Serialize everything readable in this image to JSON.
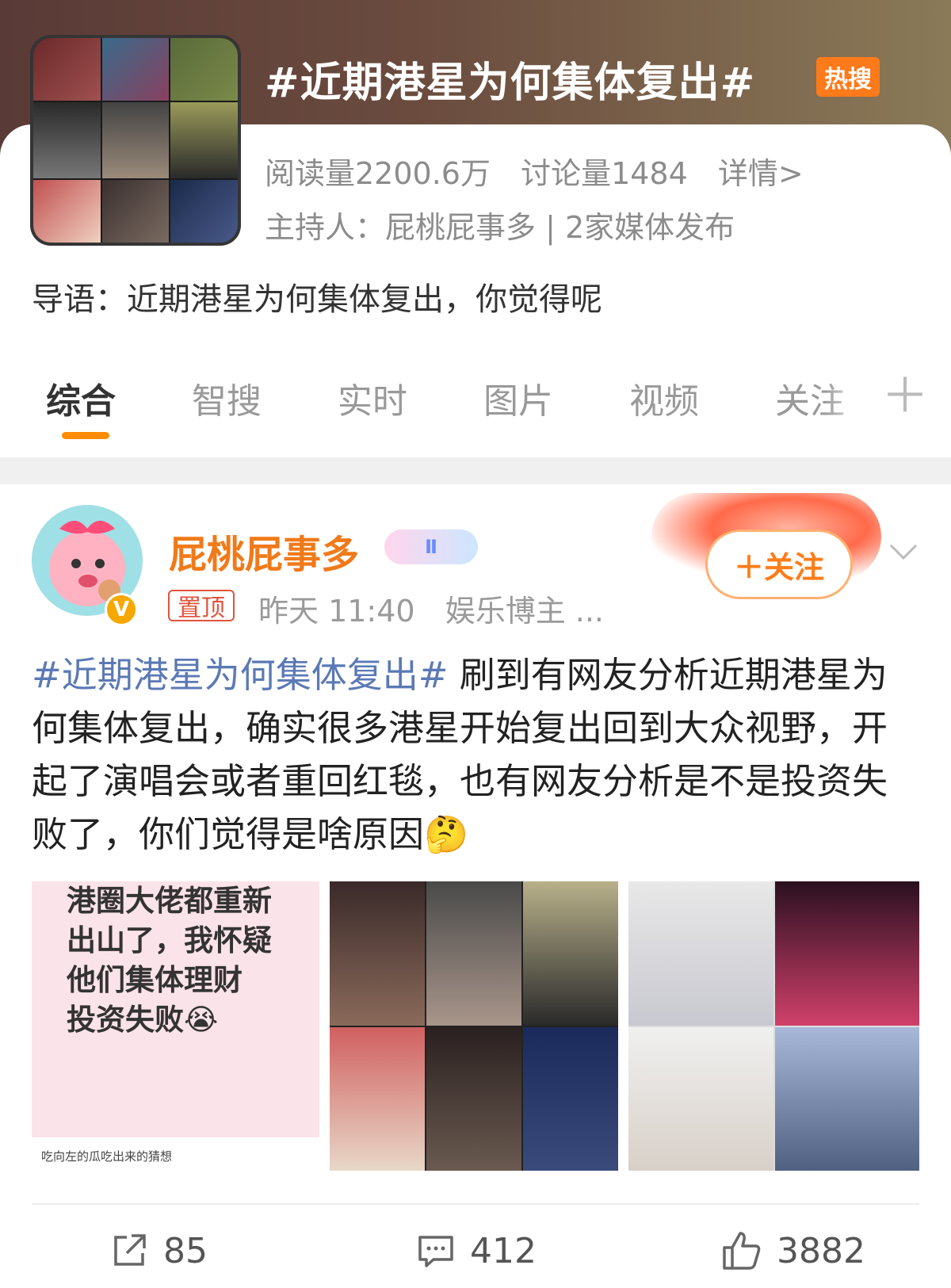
{
  "topic": {
    "title": "#近期港星为何集体复出#",
    "badge": "热搜",
    "reads": "阅读量2200.6万",
    "discussions": "讨论量1484",
    "details": "详情>",
    "host": "主持人：屁桃屁事多 | 2家媒体发布",
    "lead": "导语：近期港星为何集体复出，你觉得呢"
  },
  "tabs": [
    {
      "label": "综合"
    },
    {
      "label": "智搜"
    },
    {
      "label": "实时"
    },
    {
      "label": "图片"
    },
    {
      "label": "视频"
    },
    {
      "label": "关注"
    }
  ],
  "post": {
    "author": "屁桃屁事多",
    "level_badge": "Ⅱ",
    "pinned": "置顶",
    "time": "昨天 11:40",
    "role": "娱乐博主 ...",
    "follow": "＋关注",
    "text_tag": "#近期港星为何集体复出#",
    "text_body": " 刷到有网友分析近期港星为何集体复出，确实很多港星开始复出回到大众视野，开起了演唱会或者重回红毯，也有网友分析是不是投资失败了，你们觉得是啥原因🤔",
    "image1_text": [
      "港圈大佬都重新",
      "出山了，我怀疑",
      "他们集体理财",
      "投资失败😭"
    ],
    "image1_caption": "吃向左的瓜吃出来的猜想"
  },
  "actions": {
    "reposts": "85",
    "comments": "412",
    "likes": "3882"
  },
  "colors": {
    "accent": "#ff8c00",
    "username": "#f07a1a",
    "hashtag": "#5b79b5",
    "hot_badge": "#ff7a1a"
  }
}
